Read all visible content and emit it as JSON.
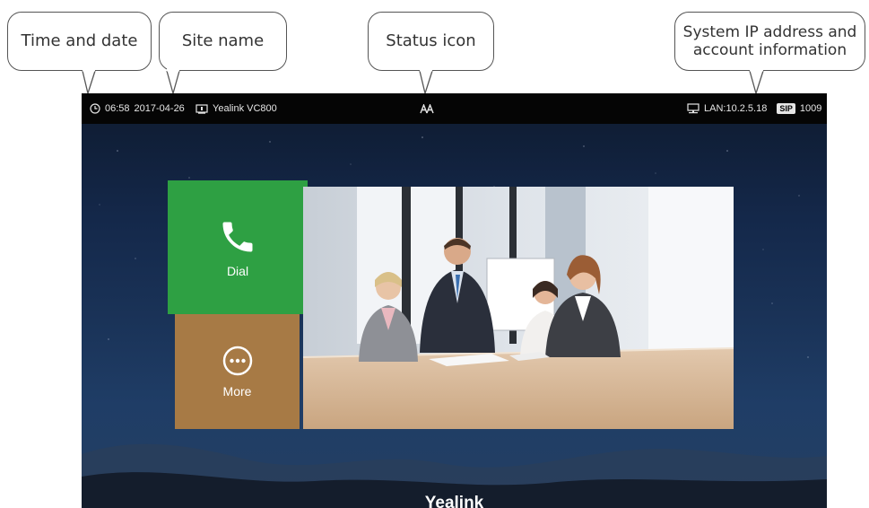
{
  "callouts": {
    "time_date": "Time and date",
    "site_name": "Site name",
    "status_icon": "Status icon",
    "system_ip_line1": "System IP address and",
    "system_ip_line2": "account information"
  },
  "statusbar": {
    "time": "06:58",
    "date": "2017-04-26",
    "site": "Yealink VC800",
    "lan": "LAN:10.2.5.18",
    "sip_badge": "SIP",
    "account": "1009"
  },
  "tiles": {
    "dial_label": "Dial",
    "more_label": "More"
  },
  "brand": "Yealink",
  "colors": {
    "dial": "#2ea043",
    "more": "#a77a45",
    "statusbar": "#050505"
  }
}
